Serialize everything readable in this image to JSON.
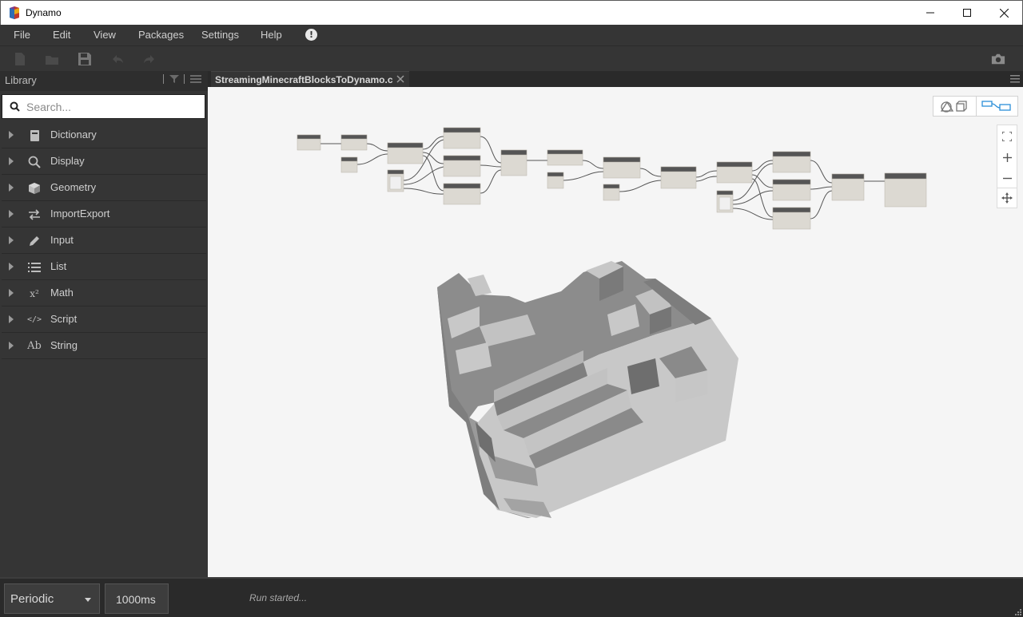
{
  "window": {
    "title": "Dynamo",
    "buttons": [
      "minimize",
      "maximize",
      "close"
    ]
  },
  "menu": {
    "items": [
      "File",
      "Edit",
      "View",
      "Packages",
      "Settings",
      "Help"
    ],
    "alert_icon": "exclamation-icon"
  },
  "toolbar": {
    "icons": [
      "new-file-icon",
      "open-file-icon",
      "save-icon",
      "undo-icon",
      "redo-icon",
      "camera-icon"
    ]
  },
  "library": {
    "title": "Library",
    "search_placeholder": "Search...",
    "categories": [
      {
        "label": "Dictionary",
        "icon": "dictionary-icon"
      },
      {
        "label": "Display",
        "icon": "search-icon"
      },
      {
        "label": "Geometry",
        "icon": "cube-icon"
      },
      {
        "label": "ImportExport",
        "icon": "arrows-icon"
      },
      {
        "label": "Input",
        "icon": "pencil-icon"
      },
      {
        "label": "List",
        "icon": "list-icon"
      },
      {
        "label": "Math",
        "icon": "x-squared-icon",
        "glyph": "x²"
      },
      {
        "label": "Script",
        "icon": "code-icon",
        "glyph": "</>"
      },
      {
        "label": "String",
        "icon": "ab-icon",
        "glyph": "Ab"
      }
    ]
  },
  "tab": {
    "label": "StreamingMinecraftBlocksToDynamo.dyn",
    "visible_label": "StreamingMinecraftBlocksToDynamo.c"
  },
  "canvas": {
    "background": "#f5f5f5",
    "view_modes": [
      "geometry-view-icon",
      "graph-view-icon"
    ],
    "active_view": "graph-view-icon",
    "accent": "#2b8fd8"
  },
  "run": {
    "mode": "Periodic",
    "interval": "1000ms",
    "status": "Run started..."
  }
}
